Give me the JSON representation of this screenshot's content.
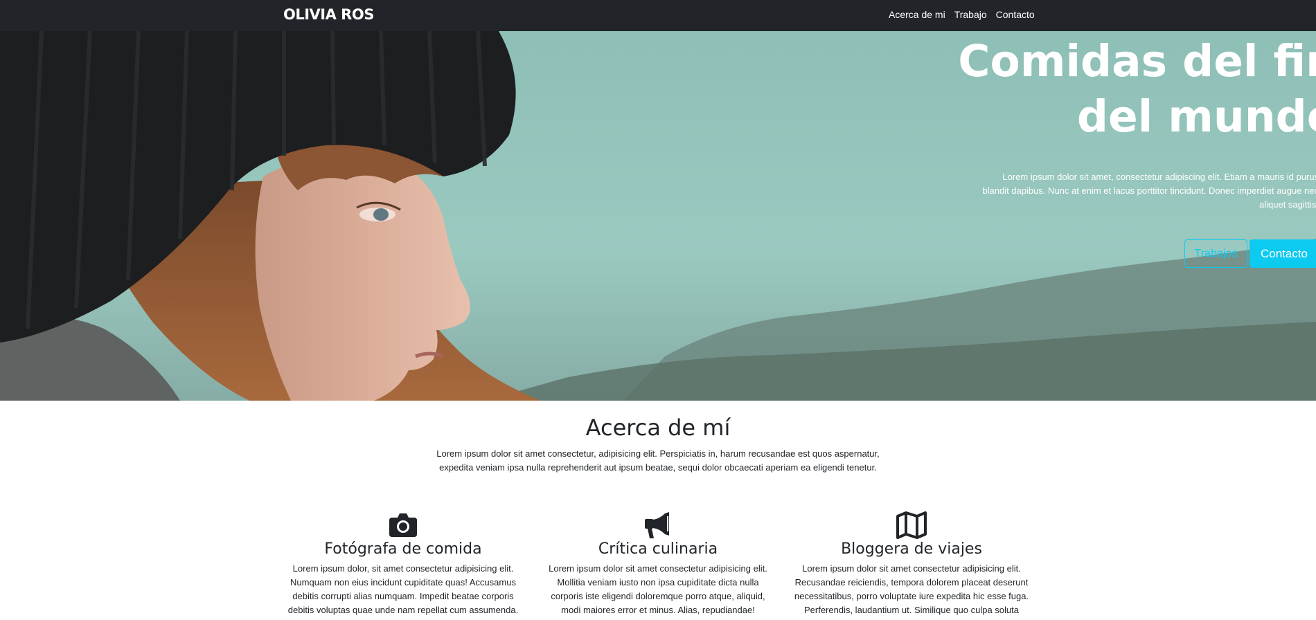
{
  "navbar": {
    "brand": "OLIVIA ROS",
    "links": [
      "Acerca de mi",
      "Trabajo",
      "Contacto"
    ]
  },
  "hero": {
    "title": "Comidas del fin\ndel mundo",
    "text": "Lorem ipsum dolor sit amet, consectetur adipiscing elit. Etiam a mauris id purus blandit dapibus. Nunc at enim et lacus porttitor tincidunt. Donec imperdiet augue nec aliquet sagittis.",
    "btn_outline": "Trabajos",
    "btn_solid": "Contacto"
  },
  "about": {
    "title": "Acerca de mí",
    "text": "Lorem ipsum dolor sit amet consectetur, adipisicing elit. Perspiciatis in, harum recusandae est quos aspernatur, expedita veniam ipsa nulla reprehenderit aut ipsum beatae, sequi dolor obcaecati aperiam ea eligendi tenetur."
  },
  "features": [
    {
      "icon": "camera-icon",
      "title": "Fotógrafa de comida",
      "text": "Lorem ipsum dolor, sit amet consectetur adipisicing elit. Numquam non eius incidunt cupiditate quas! Accusamus debitis corrupti alias numquam. Impedit beatae corporis debitis voluptas quae unde nam repellat cum assumenda."
    },
    {
      "icon": "megaphone-icon",
      "title": "Crítica culinaria",
      "text": "Lorem ipsum dolor sit amet consectetur adipisicing elit. Mollitia veniam iusto non ipsa cupiditate dicta nulla corporis iste eligendi doloremque porro atque, aliquid, modi maiores error et minus. Alias, repudiandae!"
    },
    {
      "icon": "map-icon",
      "title": "Bloggera de viajes",
      "text": "Lorem ipsum dolor sit amet consectetur adipisicing elit. Recusandae reiciendis, tempora dolorem placeat deserunt necessitatibus, porro voluptate iure expedita hic esse fuga. Perferendis, laudantium ut. Similique quo culpa soluta"
    }
  ],
  "colors": {
    "navbar": "#212529",
    "accent": "#0dcaf0",
    "hero_sky": "#93c4bb"
  }
}
